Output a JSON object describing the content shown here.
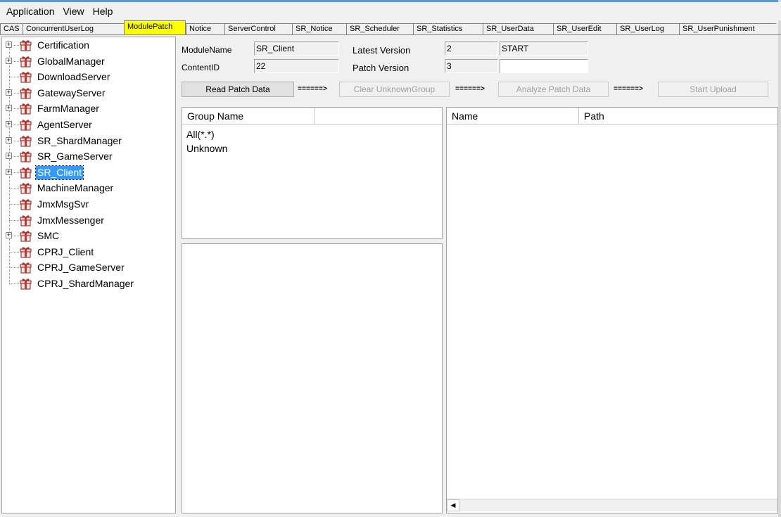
{
  "menu": {
    "items": [
      {
        "label": "Application"
      },
      {
        "label": "View"
      },
      {
        "label": "Help"
      }
    ]
  },
  "tabs": [
    {
      "label": "CAS"
    },
    {
      "label": "ConcurrentUserLog"
    },
    {
      "label": "ModulePatch",
      "active": true
    },
    {
      "label": "Notice"
    },
    {
      "label": "ServerControl"
    },
    {
      "label": "SR_Notice"
    },
    {
      "label": "SR_Scheduler"
    },
    {
      "label": "SR_Statistics"
    },
    {
      "label": "SR_UserData"
    },
    {
      "label": "SR_UserEdit"
    },
    {
      "label": "SR_UserLog"
    },
    {
      "label": "SR_UserPunishment"
    }
  ],
  "tree": {
    "nodes": [
      {
        "label": "Certification",
        "expandable": true
      },
      {
        "label": "GlobalManager",
        "expandable": true
      },
      {
        "label": "DownloadServer",
        "expandable": false
      },
      {
        "label": "GatewayServer",
        "expandable": true
      },
      {
        "label": "FarmManager",
        "expandable": true
      },
      {
        "label": "AgentServer",
        "expandable": true
      },
      {
        "label": "SR_ShardManager",
        "expandable": true
      },
      {
        "label": "SR_GameServer",
        "expandable": true
      },
      {
        "label": "SR_Client",
        "expandable": true,
        "selected": true
      },
      {
        "label": "MachineManager",
        "expandable": false
      },
      {
        "label": "JmxMsgSvr",
        "expandable": false
      },
      {
        "label": "JmxMessenger",
        "expandable": false
      },
      {
        "label": "SMC",
        "expandable": true
      },
      {
        "label": "CPRJ_Client",
        "expandable": false
      },
      {
        "label": "CPRJ_GameServer",
        "expandable": false
      },
      {
        "label": "CPRJ_ShardManager",
        "expandable": false
      }
    ]
  },
  "form": {
    "module_name_label": "ModuleName",
    "module_name_value": "SR_Client",
    "content_id_label": "ContentID",
    "content_id_value": "22",
    "latest_version_label": "Latest Version",
    "latest_version_value": "2",
    "patch_version_label": "Patch Version",
    "patch_version_value": "3",
    "status_value": "START",
    "status_input_value": ""
  },
  "actions": {
    "read_patch_data": "Read Patch Data",
    "arrow1": "======>",
    "clear_unknown_group": "Clear UnknownGroup",
    "arrow2": "======>",
    "analyze_patch_data": "Analyze Patch Data",
    "arrow3": "======>",
    "start_upload": "Start Upload"
  },
  "group_list": {
    "columns": [
      "Group Name",
      ""
    ],
    "items": [
      "All(*.*)",
      "Unknown"
    ]
  },
  "file_list": {
    "columns": [
      "Name",
      "Path"
    ],
    "scroll_left_glyph": "◀"
  },
  "colors": {
    "active_tab": "#ffff00",
    "selection": "#3399ff",
    "icon_red": "#c0392b"
  }
}
